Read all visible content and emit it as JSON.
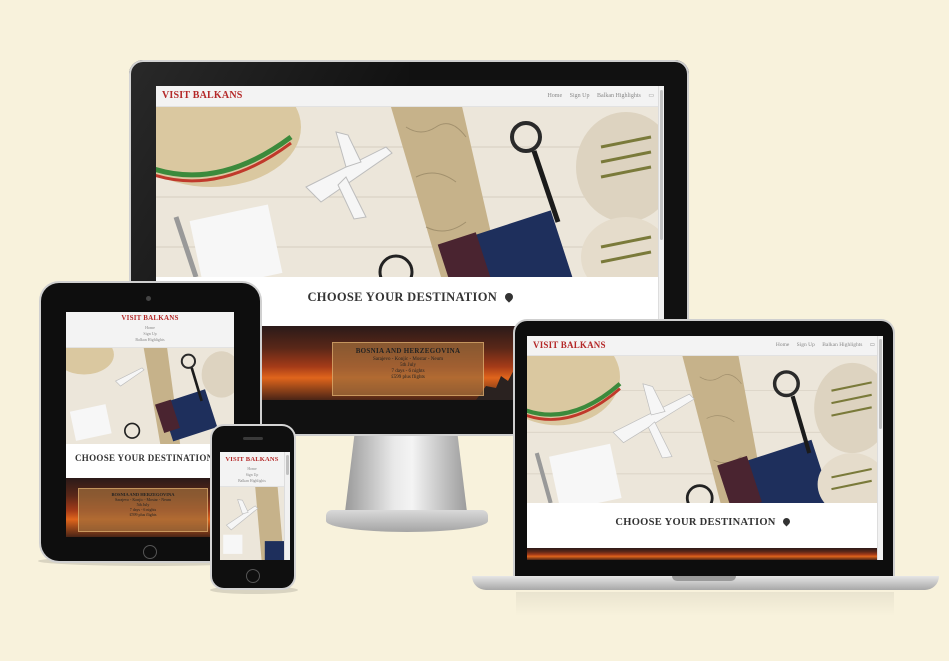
{
  "site": {
    "brand": "VISIT BALKANS",
    "nav": {
      "home": "Home",
      "signup": "Sign Up",
      "highlights": "Balkan Highlights"
    },
    "choose": "CHOOSE YOUR DESTINATION",
    "country": "BOSNIA AND HERZEGOVINA",
    "card_lines": [
      "Sarajevo - Konjic - Mostar - Neum",
      "5th July",
      "7 days - 6 nights",
      "£599 plus flights"
    ]
  },
  "colors": {
    "background": "#f8f2dc",
    "brand": "#b42828",
    "accent_sunset": "#e0651c"
  }
}
